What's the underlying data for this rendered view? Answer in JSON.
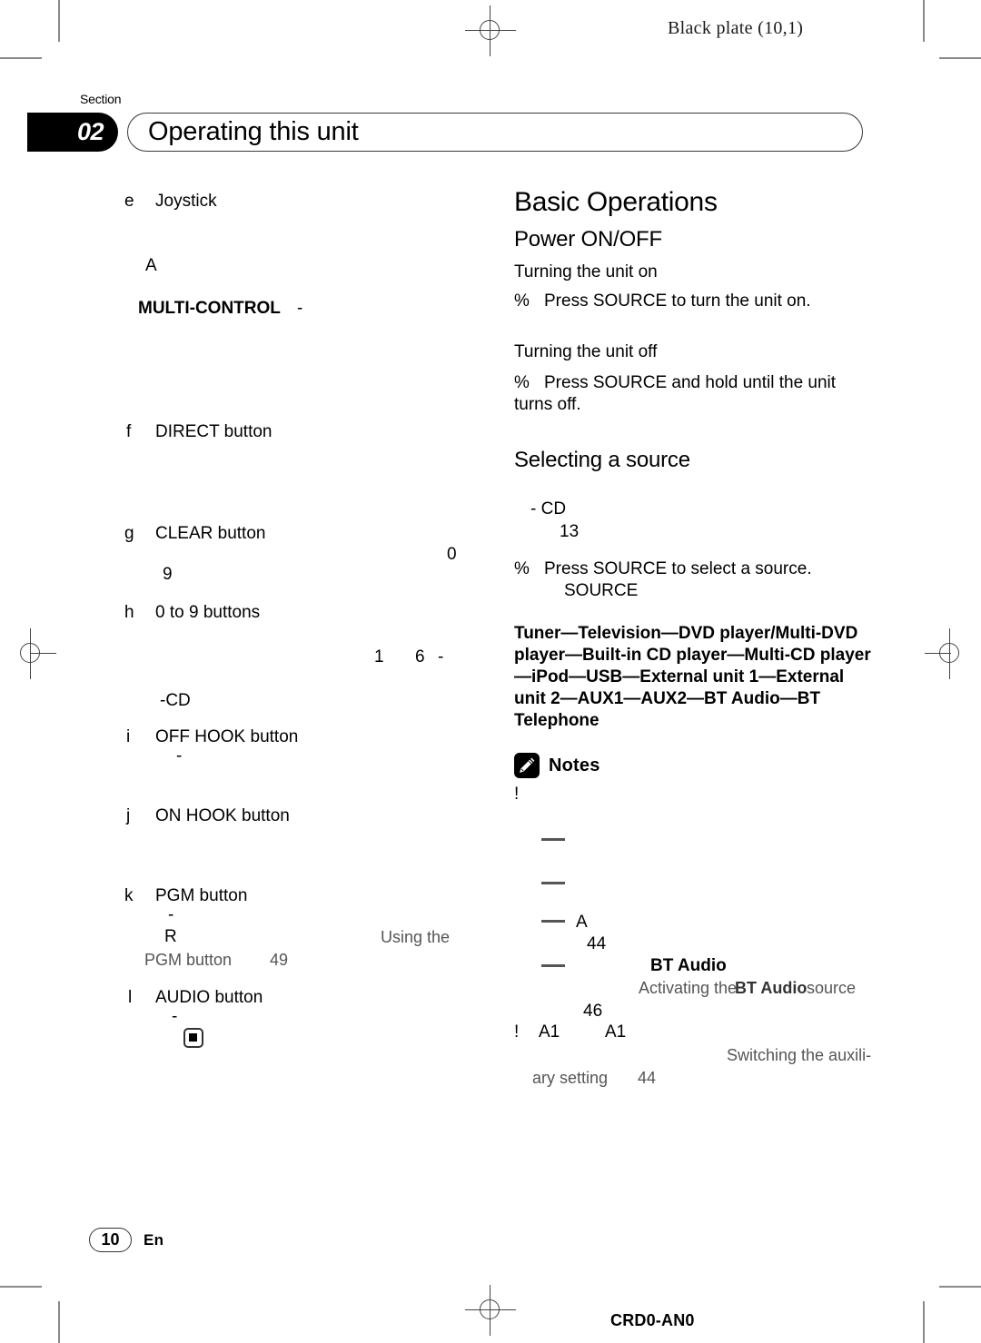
{
  "plate": {
    "label": "Black plate (10,1)"
  },
  "header": {
    "section_word": "Section",
    "section_number": "02",
    "title": "Operating this unit"
  },
  "left_column": {
    "items": [
      {
        "key": "e",
        "label": "Joystick"
      },
      {
        "key": "f",
        "label": "DIRECT button"
      },
      {
        "key": "g",
        "label": "CLEAR button"
      },
      {
        "key": "h",
        "label": "0 to 9 buttons"
      },
      {
        "key": "i",
        "label": "OFF HOOK button"
      },
      {
        "key": "j",
        "label": "ON HOOK button"
      },
      {
        "key": "k",
        "label": "PGM button"
      },
      {
        "key": "l",
        "label": "AUDIO button"
      }
    ],
    "fragments": {
      "a_letter": "A",
      "multi_control": "MULTI-CONTROL",
      "multi_control_dash": "-",
      "zero": "0",
      "nine": "9",
      "one": "1",
      "six": "6",
      "six_dash": "-",
      "dash_cd": "-CD",
      "off_hook_dash": "-",
      "pgm_dash": "-",
      "pgm_r": "R",
      "audio_dash": "-"
    },
    "references": {
      "using_the": "Using the",
      "pgm_button": "PGM button",
      "pgm_page": "49"
    }
  },
  "right_column": {
    "heading": "Basic Operations",
    "power": {
      "heading": "Power ON/OFF",
      "turn_on_heading": "Turning the unit on",
      "turn_on_bullet": "%",
      "turn_on_text": "Press SOURCE to turn the unit on.",
      "turn_off_heading": "Turning the unit off",
      "turn_off_bullet": "%",
      "turn_off_text_line1": "Press SOURCE and hold until the unit",
      "turn_off_text_line2": "turns off."
    },
    "selecting": {
      "heading": "Selecting a source",
      "frag_cd": "- CD",
      "frag_13": "13",
      "bullet": "%",
      "text": "Press SOURCE to select a source.",
      "source_word": "SOURCE",
      "source_order": "Tuner—Television—DVD player/Multi-DVD player—Built-in CD player—Multi-CD player—iPod—USB—External unit 1—External unit 2—AUX1—AUX2—BT Audio—BT Telephone"
    },
    "notes": {
      "label": "Notes",
      "icon": "pencil-icon",
      "bullet1": "!",
      "dash1": "—",
      "dash2": "—",
      "dash3": "—",
      "frag_a": "A",
      "frag_44": "44",
      "dash4": "—",
      "frag_bt_audio": "BT Audio",
      "ref_activating_pre": "Activating the",
      "ref_activating_bold": "BT Audio",
      "ref_activating_post": "source",
      "frag_46": "46",
      "bullet2": "!",
      "frag_a1_first": "A1",
      "frag_a1_second": "A1",
      "ref_switching_line1": "Switching the auxili-",
      "ref_switching_line2": "ary setting",
      "ref_switching_page": "44"
    }
  },
  "footer": {
    "page_number": "10",
    "language": "En",
    "doc_code": "CRD0-AN0"
  }
}
